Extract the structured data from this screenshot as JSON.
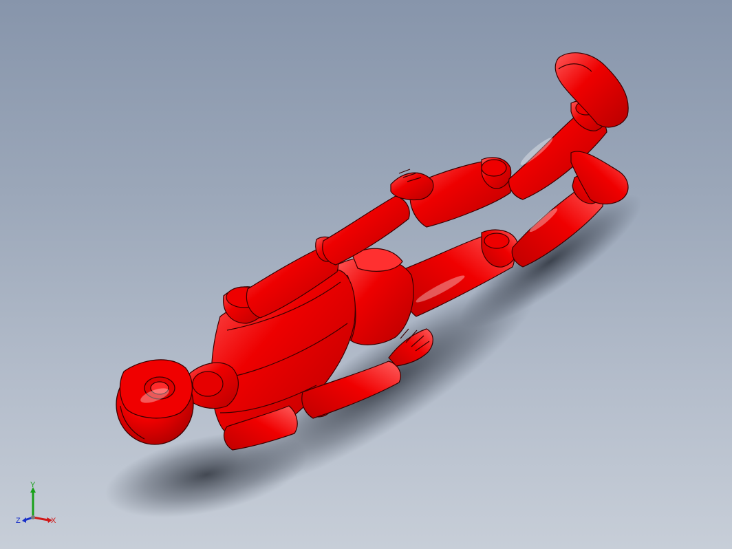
{
  "viewport": {
    "background_top": "#8795ab",
    "background_bottom": "#c7ced8"
  },
  "model": {
    "color": "#ee0000",
    "shade_color": "#b00000",
    "highlight_color": "#ff6a6a",
    "edge_color": "#3a0000"
  },
  "triad": {
    "x_label": "X",
    "y_label": "Y",
    "z_label": "Z",
    "x_color": "#d01818",
    "y_color": "#18a018",
    "z_color": "#1830c8"
  }
}
